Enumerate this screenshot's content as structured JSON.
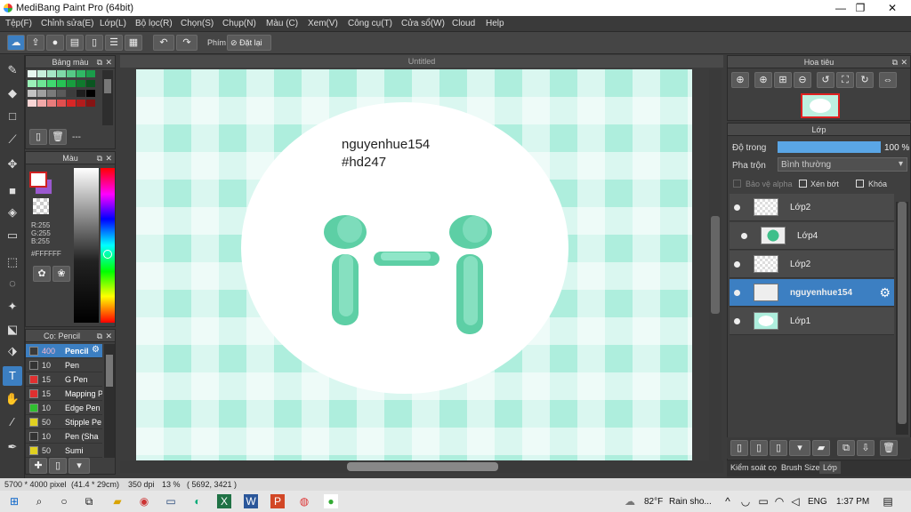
{
  "window": {
    "title": "MediBang Paint Pro (64bit)",
    "minimize": "—",
    "maximize": "❐",
    "close": "✕"
  },
  "menu": [
    "Tệp(F)",
    "Chỉnh sửa(E)",
    "Lớp(L)",
    "Bộ lọc(R)",
    "Chọn(S)",
    "Chụp(N)",
    "Màu (C)",
    "Xem(V)",
    "Công cụ(T)",
    "Cửa sổ(W)",
    "Cloud",
    "Help"
  ],
  "toolbar": {
    "shortcut_label": "Phím",
    "reset_label": "Đặt lại"
  },
  "palette_panel": {
    "title": "Bảng màu",
    "dashes": "---"
  },
  "color_panel": {
    "title": "Màu",
    "r": "R:255",
    "g": "G:255",
    "b": "B:255",
    "hex": "#FFFFFF"
  },
  "brush_panel": {
    "title": "Cọ: Pencil",
    "items": [
      {
        "size": "400",
        "name": "Pencil",
        "color": "#3a3a3a"
      },
      {
        "size": "10",
        "name": "Pen",
        "color": "#333333"
      },
      {
        "size": "15",
        "name": "G Pen",
        "color": "#e03030"
      },
      {
        "size": "15",
        "name": "Mapping P",
        "color": "#e03030"
      },
      {
        "size": "10",
        "name": "Edge Pen",
        "color": "#30c030"
      },
      {
        "size": "50",
        "name": "Stipple Pe",
        "color": "#e0d020"
      },
      {
        "size": "10",
        "name": "Pen (Sha",
        "color": "#333333"
      },
      {
        "size": "50",
        "name": "Sumi",
        "color": "#e0d020"
      }
    ]
  },
  "canvas": {
    "tab_title": "Untitled",
    "text_line1": "nguyenhue154",
    "text_line2": "#hd247"
  },
  "navigator": {
    "title": "Hoa tiêu"
  },
  "layer_panel": {
    "title": "Lớp",
    "opacity_label": "Độ trong",
    "opacity_value": "100 %",
    "opacity": 1.0,
    "blend_label": "Pha trộn",
    "blend_value": "Bình thường",
    "protect_alpha": "Bảo vệ alpha",
    "clipping": "Xén bớt",
    "lock": "Khóa",
    "layers": [
      {
        "name": "Lớp2",
        "selected": false
      },
      {
        "name": "Lớp4",
        "selected": false
      },
      {
        "name": "Lớp2",
        "selected": false
      },
      {
        "name": "nguyenhue154",
        "selected": true
      },
      {
        "name": "Lớp1",
        "selected": false
      }
    ],
    "bottom_tabs": [
      "Kiểm soát cọ",
      "Brush Size",
      "Lớp"
    ]
  },
  "status": {
    "size": "5700 * 4000 pixel",
    "cm": "(41.4 * 29cm)",
    "dpi": "350 dpi",
    "zoom": "13 %",
    "coords": "( 5692, 3421 )"
  },
  "taskbar": {
    "weather_temp": "82°F",
    "weather_text": "Rain sho...",
    "lang": "ENG",
    "time": "1:37 PM"
  },
  "colors": {
    "accent": "#3c7fc2",
    "canvas_mint": "#aeeedd",
    "character": "#5dcfa5"
  }
}
